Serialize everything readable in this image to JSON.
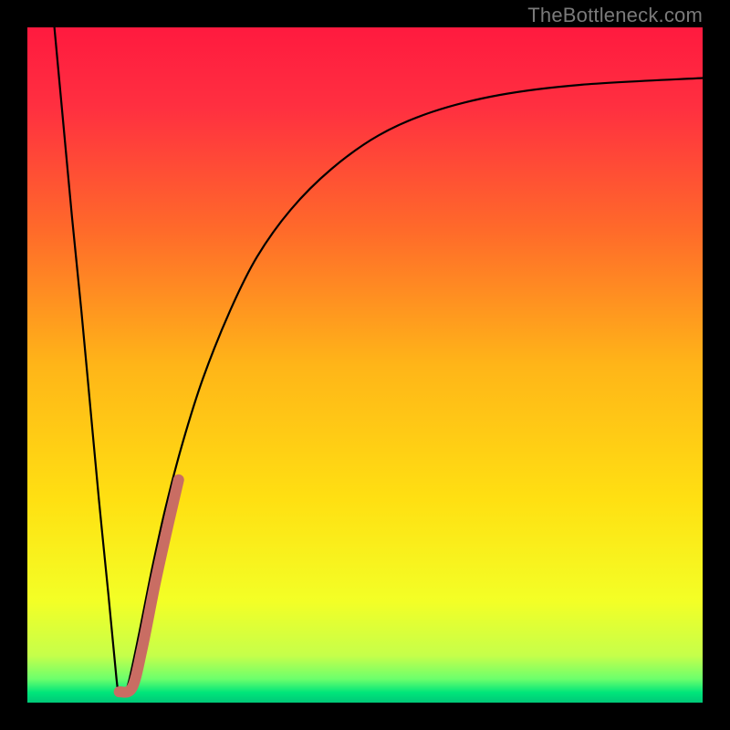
{
  "watermark": "TheBottleneck.com",
  "chart_data": {
    "type": "line",
    "title": "",
    "xlabel": "",
    "ylabel": "",
    "xlim": [
      0,
      100
    ],
    "ylim": [
      0,
      100
    ],
    "grid": false,
    "gradient_stops": [
      {
        "offset": 0.0,
        "color": "#ff1a3f"
      },
      {
        "offset": 0.12,
        "color": "#ff3040"
      },
      {
        "offset": 0.3,
        "color": "#ff6a2a"
      },
      {
        "offset": 0.5,
        "color": "#ffb518"
      },
      {
        "offset": 0.7,
        "color": "#ffe012"
      },
      {
        "offset": 0.85,
        "color": "#f3ff26"
      },
      {
        "offset": 0.93,
        "color": "#c6ff4a"
      },
      {
        "offset": 0.965,
        "color": "#6cff6c"
      },
      {
        "offset": 0.985,
        "color": "#00e57a"
      },
      {
        "offset": 1.0,
        "color": "#00c878"
      }
    ],
    "series": [
      {
        "name": "bottleneck-curve",
        "color": "#000000",
        "width": 2.2,
        "points": [
          {
            "x": 4.0,
            "y": 100.0
          },
          {
            "x": 5.3,
            "y": 86.0
          },
          {
            "x": 6.6,
            "y": 72.0
          },
          {
            "x": 8.0,
            "y": 58.0
          },
          {
            "x": 9.3,
            "y": 44.0
          },
          {
            "x": 10.6,
            "y": 30.0
          },
          {
            "x": 12.0,
            "y": 16.0
          },
          {
            "x": 13.2,
            "y": 3.5
          },
          {
            "x": 13.6,
            "y": 1.4
          },
          {
            "x": 14.3,
            "y": 1.4
          },
          {
            "x": 15.0,
            "y": 3.0
          },
          {
            "x": 16.5,
            "y": 10.0
          },
          {
            "x": 18.5,
            "y": 20.0
          },
          {
            "x": 20.5,
            "y": 29.0
          },
          {
            "x": 23.0,
            "y": 38.5
          },
          {
            "x": 26.0,
            "y": 48.0
          },
          {
            "x": 30.0,
            "y": 58.0
          },
          {
            "x": 34.0,
            "y": 66.0
          },
          {
            "x": 39.0,
            "y": 73.0
          },
          {
            "x": 45.0,
            "y": 79.0
          },
          {
            "x": 52.0,
            "y": 84.0
          },
          {
            "x": 60.0,
            "y": 87.5
          },
          {
            "x": 70.0,
            "y": 90.0
          },
          {
            "x": 82.0,
            "y": 91.5
          },
          {
            "x": 100.0,
            "y": 92.5
          }
        ]
      },
      {
        "name": "highlight-segment",
        "color": "#c96d63",
        "width": 12,
        "linecap": "round",
        "points": [
          {
            "x": 13.6,
            "y": 1.6
          },
          {
            "x": 15.5,
            "y": 2.2
          },
          {
            "x": 17.0,
            "y": 8.0
          },
          {
            "x": 19.0,
            "y": 18.0
          },
          {
            "x": 21.0,
            "y": 27.0
          },
          {
            "x": 22.4,
            "y": 33.0
          }
        ]
      }
    ]
  }
}
